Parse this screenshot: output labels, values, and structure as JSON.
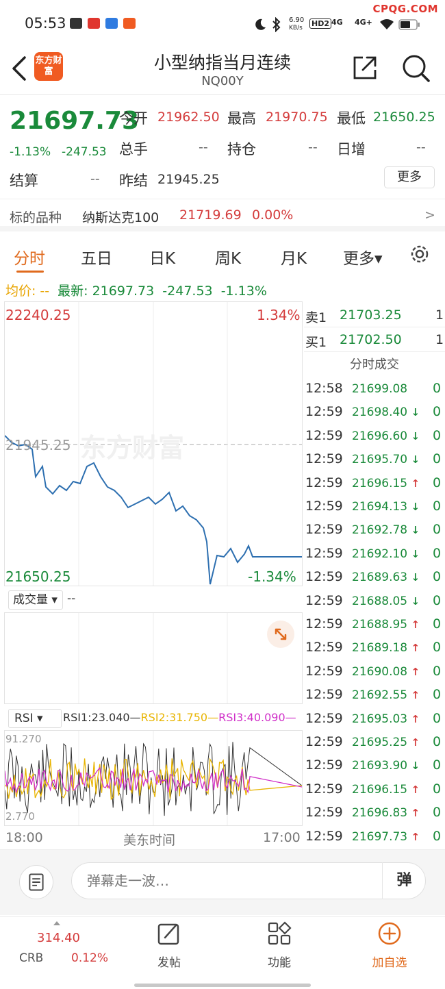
{
  "status_bar": {
    "time": "05:53",
    "net_speed": "6.90",
    "net_unit": "KB/s",
    "hd_label": "HD2",
    "net1": "4G",
    "net2": "4G+",
    "watermark": "CPQG.COM"
  },
  "header": {
    "logo_text": "东方财富",
    "title": "小型纳指当月连续",
    "code": "NQ00Y"
  },
  "quote": {
    "last": "21697.73",
    "change_pct": "-1.13%",
    "change": "-247.53",
    "open_label": "今开",
    "open": "21962.50",
    "high_label": "最高",
    "high": "21970.75",
    "low_label": "最低",
    "low": "21650.25",
    "volume_label": "总手",
    "volume": "--",
    "oi_label": "持仓",
    "oi": "--",
    "daily_inc_label": "日增",
    "daily_inc": "--",
    "settle_label": "结算",
    "settle": "--",
    "prev_settle_label": "昨结",
    "prev_settle": "21945.25",
    "more_button": "更多"
  },
  "underlying": {
    "label": "标的品种",
    "name": "纳斯达克100",
    "price": "21719.69",
    "pct": "0.00%",
    "chevron": ">"
  },
  "tabs": [
    "分时",
    "五日",
    "日K",
    "周K",
    "月K",
    "更多▾"
  ],
  "legend": {
    "avg_label": "均价:",
    "avg_value": "--",
    "latest_label": "最新:",
    "latest_value": "21697.73",
    "latest_change": "-247.53",
    "latest_pct": "-1.13%"
  },
  "chart_labels": {
    "top_price": "22240.25",
    "top_pct": "1.34%",
    "mid_price": "21945.25",
    "bottom_price": "21650.25",
    "bottom_pct": "-1.34%",
    "chart_watermark": "东方财富"
  },
  "volume": {
    "selector": "成交量 ▾",
    "value": "--"
  },
  "rsi": {
    "selector": "RSI ▾",
    "rsi1": "RSI1:23.040—",
    "rsi2": "RSI2:31.750—",
    "rsi3": "RSI3:40.090—",
    "max": "91.270",
    "min": "2.770",
    "colors": {
      "rsi1": "#333333",
      "rsi2": "#e8b400",
      "rsi3": "#d030c8"
    }
  },
  "time_axis": {
    "start": "18:00",
    "mid": "美东时间",
    "end": "17:00"
  },
  "orderbook": [
    {
      "label": "卖1",
      "price": "21703.25",
      "qty": "1"
    },
    {
      "label": "买1",
      "price": "21702.50",
      "qty": "1"
    }
  ],
  "ticks_title": "分时成交",
  "ticks": [
    {
      "time": "12:58",
      "price": "21699.08",
      "dir": "",
      "qty": "0"
    },
    {
      "time": "12:59",
      "price": "21698.40",
      "dir": "down",
      "qty": "0"
    },
    {
      "time": "12:59",
      "price": "21696.60",
      "dir": "down",
      "qty": "0"
    },
    {
      "time": "12:59",
      "price": "21695.70",
      "dir": "down",
      "qty": "0"
    },
    {
      "time": "12:59",
      "price": "21696.15",
      "dir": "up",
      "qty": "0"
    },
    {
      "time": "12:59",
      "price": "21694.13",
      "dir": "down",
      "qty": "0"
    },
    {
      "time": "12:59",
      "price": "21692.78",
      "dir": "down",
      "qty": "0"
    },
    {
      "time": "12:59",
      "price": "21692.10",
      "dir": "down",
      "qty": "0"
    },
    {
      "time": "12:59",
      "price": "21689.63",
      "dir": "down",
      "qty": "0"
    },
    {
      "time": "12:59",
      "price": "21688.05",
      "dir": "down",
      "qty": "0"
    },
    {
      "time": "12:59",
      "price": "21688.95",
      "dir": "up",
      "qty": "0"
    },
    {
      "time": "12:59",
      "price": "21689.18",
      "dir": "up",
      "qty": "0"
    },
    {
      "time": "12:59",
      "price": "21690.08",
      "dir": "up",
      "qty": "0"
    },
    {
      "time": "12:59",
      "price": "21692.55",
      "dir": "up",
      "qty": "0"
    },
    {
      "time": "12:59",
      "price": "21695.03",
      "dir": "up",
      "qty": "0"
    },
    {
      "time": "12:59",
      "price": "21695.25",
      "dir": "up",
      "qty": "0"
    },
    {
      "time": "12:59",
      "price": "21693.90",
      "dir": "down",
      "qty": "0"
    },
    {
      "time": "12:59",
      "price": "21696.15",
      "dir": "up",
      "qty": "0"
    },
    {
      "time": "12:59",
      "price": "21696.83",
      "dir": "up",
      "qty": "0"
    },
    {
      "time": "12:59",
      "price": "21697.73",
      "dir": "up",
      "qty": "0"
    }
  ],
  "input": {
    "placeholder": "弹幕走一波…",
    "danmu_button": "弹"
  },
  "bottom_nav": {
    "crb_value": "314.40",
    "crb_name": "CRB",
    "crb_pct": "0.12%",
    "post": "发帖",
    "functions": "功能",
    "add_watch": "加自选"
  },
  "colors": {
    "up": "#d43c3c",
    "down": "#1a8a3a",
    "accent": "#e06a1d",
    "line": "#2d6fb0"
  }
}
